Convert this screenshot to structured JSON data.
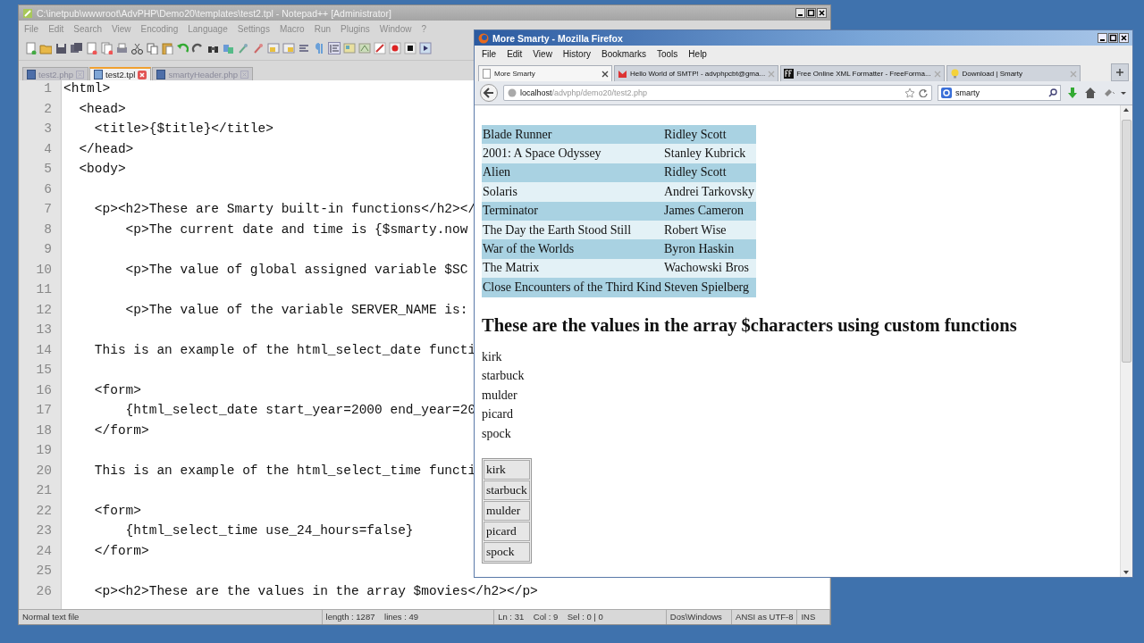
{
  "notepad": {
    "title": "C:\\inetpub\\wwwroot\\AdvPHP\\Demo20\\templates\\test2.tpl - Notepad++ [Administrator]",
    "menu": [
      "File",
      "Edit",
      "Search",
      "View",
      "Encoding",
      "Language",
      "Settings",
      "Macro",
      "Run",
      "Plugins",
      "Window",
      "?"
    ],
    "tabs": [
      {
        "label": "test2.php",
        "selected": false
      },
      {
        "label": "test2.tpl",
        "selected": true
      },
      {
        "label": "smartyHeader.php",
        "selected": false
      }
    ],
    "lines": [
      {
        "number": "1",
        "code": "<html>"
      },
      {
        "number": "2",
        "code": "  <head>"
      },
      {
        "number": "3",
        "code": "    <title>{$title}</title>"
      },
      {
        "number": "4",
        "code": "  </head>"
      },
      {
        "number": "5",
        "code": "  <body>"
      },
      {
        "number": "6"
      },
      {
        "number": "7",
        "code": "    <p><h2>These are Smarty built-in functions</h2></"
      },
      {
        "number": "8",
        "code": "        <p>The current date and time is {$smarty.now"
      },
      {
        "number": "9"
      },
      {
        "number": "10",
        "code": "        <p>The value of global assigned variable $SC"
      },
      {
        "number": "11"
      },
      {
        "number": "12",
        "code": "        <p>The value of the variable SERVER_NAME is:"
      },
      {
        "number": "13"
      },
      {
        "number": "14",
        "code": "    This is an example of the html_select_date functi"
      },
      {
        "number": "15"
      },
      {
        "number": "16",
        "code": "    <form>"
      },
      {
        "number": "17",
        "code": "        {html_select_date start_year=2000 end_year=20"
      },
      {
        "number": "18",
        "code": "    </form>"
      },
      {
        "number": "19"
      },
      {
        "number": "20",
        "code": "    This is an example of the html_select_time functi"
      },
      {
        "number": "21"
      },
      {
        "number": "22",
        "code": "    <form>"
      },
      {
        "number": "23",
        "code": "        {html_select_time use_24_hours=false}"
      },
      {
        "number": "24",
        "code": "    </form>"
      },
      {
        "number": "25"
      },
      {
        "number": "26",
        "code": "    <p><h2>These are the values in the array $movies</h2></p>"
      }
    ],
    "status_bar": [
      "Normal text file",
      "length : 1287    lines : 49",
      "Ln : 31    Col : 9    Sel : 0 | 0",
      "Dos\\Windows",
      "ANSI as UTF-8",
      "INS"
    ]
  },
  "firefox": {
    "title": "More Smarty - Mozilla Firefox",
    "menu": [
      "File",
      "Edit",
      "View",
      "History",
      "Bookmarks",
      "Tools",
      "Help"
    ],
    "tabs": [
      {
        "label": "More Smarty",
        "selected": true,
        "kind": "page"
      },
      {
        "label": "Hello World of SMTP! - advphpcbt@gma...",
        "selected": false,
        "kind": "mail"
      },
      {
        "label": "Free Online XML Formatter - FreeForma...",
        "selected": false,
        "kind": "ff"
      },
      {
        "label": "Download | Smarty",
        "selected": false,
        "kind": "bulb"
      }
    ],
    "url": {
      "host": "localhost",
      "path": "/advphp/demo20/test2.php"
    },
    "search": "smarty",
    "movies": [
      {
        "title": "Blade Runner",
        "director": "Ridley Scott"
      },
      {
        "title": "2001: A Space Odyssey",
        "director": "Stanley Kubrick"
      },
      {
        "title": "Alien",
        "director": "Ridley Scott"
      },
      {
        "title": "Solaris",
        "director": "Andrei Tarkovsky"
      },
      {
        "title": "Terminator",
        "director": "James Cameron"
      },
      {
        "title": "The Day the Earth Stood Still",
        "director": "Robert Wise"
      },
      {
        "title": "War of the Worlds",
        "director": "Byron Haskin"
      },
      {
        "title": "The Matrix",
        "director": "Wachowski Bros"
      },
      {
        "title": "Close Encounters of the Third Kind",
        "director": "Steven Spielberg"
      }
    ],
    "heading": "These are the values in the array $characters using custom functions",
    "characters": [
      "kirk",
      "starbuck",
      "mulder",
      "picard",
      "spock"
    ],
    "listbox": [
      "kirk",
      "starbuck",
      "mulder",
      "picard",
      "spock"
    ]
  }
}
